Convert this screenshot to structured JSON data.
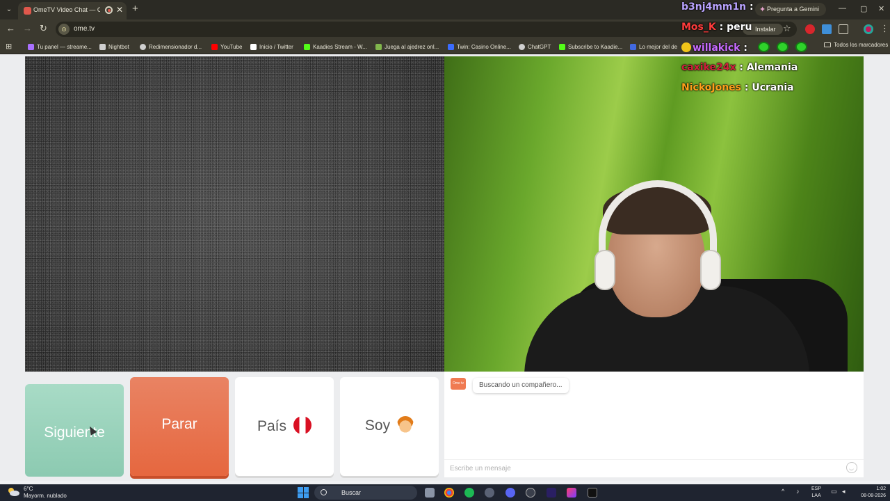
{
  "browser": {
    "tab_title": "OmeTV Video Chat — Ome",
    "tab_close": "✕",
    "new_tab": "+",
    "gemini_label": "Pregunta a Gemini",
    "url": "ome.tv",
    "install_label": "Instalar",
    "window_controls": {
      "minimize": "—",
      "maximize": "▢",
      "close": "✕"
    }
  },
  "bookmarks": {
    "items": [
      {
        "label": "Tu panel — streame...",
        "color": "#a970ff"
      },
      {
        "label": "Nightbot",
        "color": "#cfcfcf"
      },
      {
        "label": "Redimensionador d...",
        "color": "#cfcfcf"
      },
      {
        "label": "YouTube",
        "color": "#ff0000"
      },
      {
        "label": "Inicio / Twitter",
        "color": "#ffffff"
      },
      {
        "label": "Kaadies Stream - W...",
        "color": "#53fc18"
      },
      {
        "label": "Juega al ajedrez onl...",
        "color": "#81b64c"
      },
      {
        "label": "Twin: Casino Online...",
        "color": "#3b6cff"
      },
      {
        "label": "ChatGPT",
        "color": "#cfcfcf"
      },
      {
        "label": "Subscribe to Kaadie...",
        "color": "#53fc18"
      },
      {
        "label": "Lo mejor del de",
        "color": "#4169e1"
      }
    ],
    "all_label": "Todos los marcadores"
  },
  "stream_chat": [
    {
      "user": "b3nj4mm1n",
      "color": "#b9a3ff",
      "message": ""
    },
    {
      "user": "Mos_K",
      "color": "#ff3c3c",
      "message": "peru"
    },
    {
      "user": "willakick",
      "color": "#c76bff",
      "message": ""
    },
    {
      "user": "caxike24x",
      "color": "#d01f3c",
      "message": "Alemania"
    },
    {
      "user": "NickoJones",
      "color": "#ff9f1a",
      "message": "Ucrania"
    }
  ],
  "controls": {
    "next_label": "Siguiente",
    "stop_label": "Parar",
    "country_label": "País",
    "gender_label": "Soy"
  },
  "chat": {
    "logo_text": "Ome tv",
    "status_message": "Buscando un compañero...",
    "input_placeholder": "Escribe un mensaje"
  },
  "taskbar": {
    "temperature": "6°C",
    "weather_desc": "Mayorm. nublado",
    "search_label": "Buscar",
    "lang_top": "ESP",
    "lang_bottom": "LAA",
    "time": "1:02",
    "date": "08-08-2026"
  },
  "colors": {
    "next_button": "#9cd3bc",
    "stop_button": "#e6673f",
    "accent_green": "#2fd32b"
  }
}
